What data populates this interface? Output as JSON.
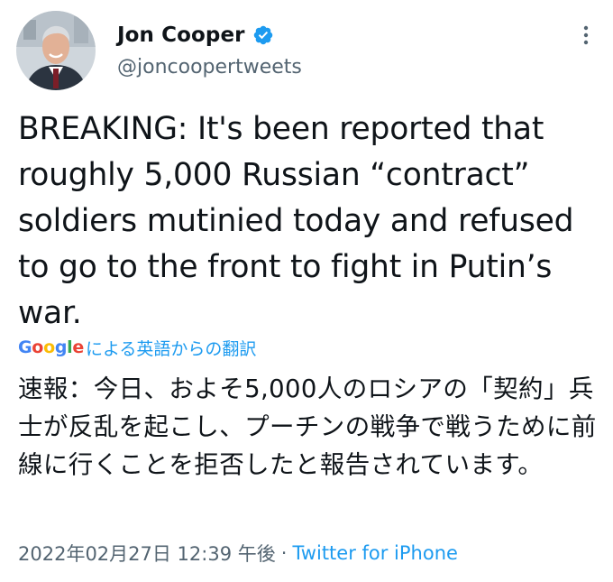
{
  "author": {
    "display_name": "Jon Cooper",
    "handle": "@joncoopertweets",
    "verified": true,
    "avatar_icon": "profile-photo"
  },
  "tweet": {
    "text": "BREAKING: It's been reported that roughly 5,000 Russian “contract” soldiers mutinied today and refused to go to the front to fight in Putin’s war.",
    "translate_label": "による英語からの翻訳",
    "translated_text": "速報：今日、およそ5,000人のロシアの「契約」兵士が反乱を起こし、プーチンの戦争で戦うために前線に行くことを拒否したと報告されています。"
  },
  "translation_provider": {
    "letters": [
      "G",
      "o",
      "o",
      "g",
      "l",
      "e"
    ],
    "colors": [
      "#4285F4",
      "#EA4335",
      "#FBBC05",
      "#4285F4",
      "#34A853",
      "#EA4335"
    ]
  },
  "meta": {
    "timestamp": "2022年02月27日 12:39 午後",
    "separator": "·",
    "source": "Twitter for iPhone"
  },
  "colors": {
    "text_primary": "#0f1419",
    "text_secondary": "#536471",
    "link_blue": "#1d9bf0",
    "verified_blue": "#1d9bf0"
  }
}
